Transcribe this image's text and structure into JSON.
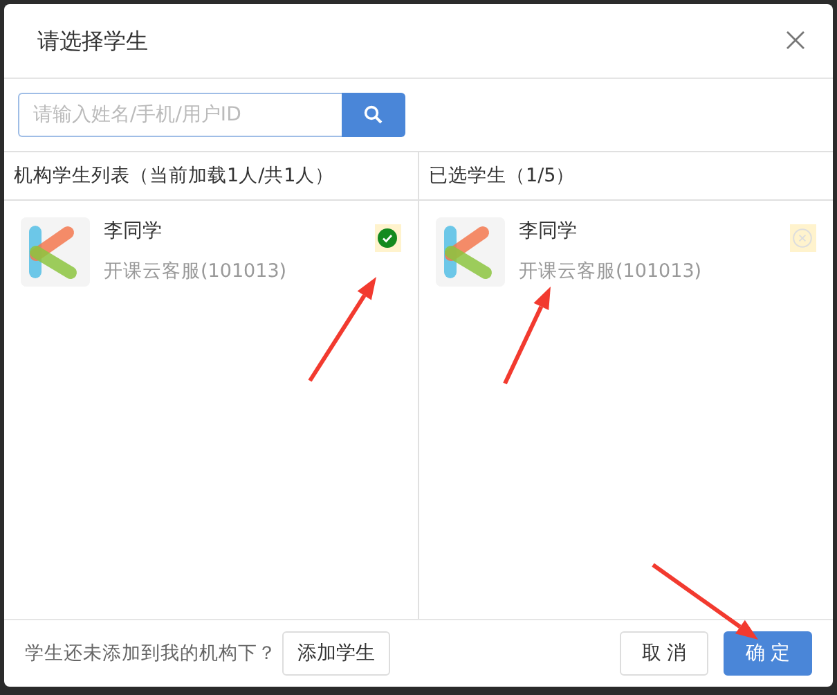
{
  "dialog": {
    "title": "请选择学生"
  },
  "search": {
    "placeholder": "请输入姓名/手机/用户ID"
  },
  "panels": [
    {
      "kind": "source",
      "header": "机构学生列表（当前加载1人/共1人）",
      "students": [
        {
          "name": "李同学",
          "detail": "开课云客服(101013)",
          "selected": true
        }
      ]
    },
    {
      "kind": "chosen",
      "header": "已选学生（1/5）",
      "students": [
        {
          "name": "李同学",
          "detail": "开课云客服(101013)"
        }
      ]
    }
  ],
  "footer": {
    "hint": "学生还未添加到我的机构下？",
    "add_button": "添加学生",
    "cancel_button": "取 消",
    "confirm_button": "确 定"
  }
}
